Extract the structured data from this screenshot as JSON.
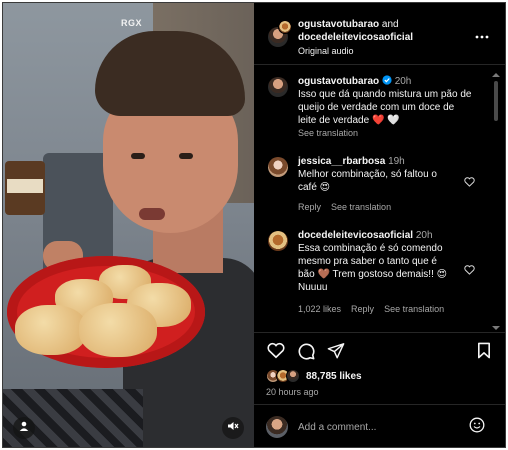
{
  "video": {
    "watermark": "RGX"
  },
  "header": {
    "author_1": "ogustavotubarao",
    "and_text": "and",
    "author_2": "docedeleitevicosaoficial",
    "audio": "Original audio",
    "more_icon": "more-horizontal-icon"
  },
  "caption": {
    "username": "ogustavotubarao",
    "time": "20h",
    "line1": "Isso que dá quando mistura um pão de",
    "line2": "queijo de verdade com um doce de",
    "line3": "leite de verdade ❤️ 🤍",
    "see_translation": "See translation"
  },
  "comments": [
    {
      "username": "jessica__rbarbosa",
      "time": "19h",
      "line1": "Melhor combinação, só faltou o",
      "line2": "café 😍",
      "reply": "Reply",
      "see_translation": "See translation"
    },
    {
      "username": "docedeleitevicosaoficial",
      "time": "20h",
      "line1": "Essa combinação é só comendo",
      "line2": "mesmo pra saber o tanto que é",
      "line3": "bão 🤎 Trem gostoso demais!! 😍",
      "line4": "Nuuuu",
      "likes": "1,022 likes",
      "reply": "Reply",
      "see_translation": "See translation"
    }
  ],
  "actions": {
    "likes": "88,785 likes",
    "time_ago": "20 hours ago"
  },
  "composer": {
    "placeholder": "Add a comment..."
  },
  "colors": {
    "background": "#000000",
    "verified": "#0095f6",
    "like_red": "#ff3040"
  }
}
